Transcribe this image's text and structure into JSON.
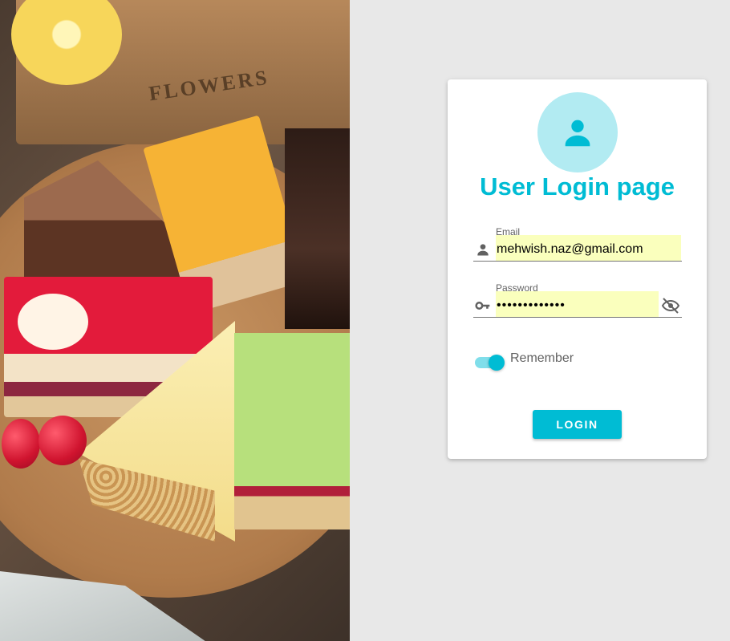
{
  "photo": {
    "alt": "Assorted cake slices on a wooden board",
    "crate_text": "FLOWERS"
  },
  "login": {
    "title": "User Login page",
    "email": {
      "label": "Email",
      "value": "mehwish.naz@gmail.com",
      "icon": "person-icon"
    },
    "password": {
      "label": "Password",
      "value": "•••••••••••••",
      "icon": "key-icon",
      "toggle_icon": "eye-off-icon"
    },
    "remember": {
      "label": "Remember",
      "checked": true
    },
    "submit_label": "LOGIN"
  },
  "colors": {
    "accent": "#00bcd4",
    "avatar_bg": "#b2ebf2",
    "autofill_bg": "#faffbd",
    "page_bg": "#e8e8e8"
  }
}
